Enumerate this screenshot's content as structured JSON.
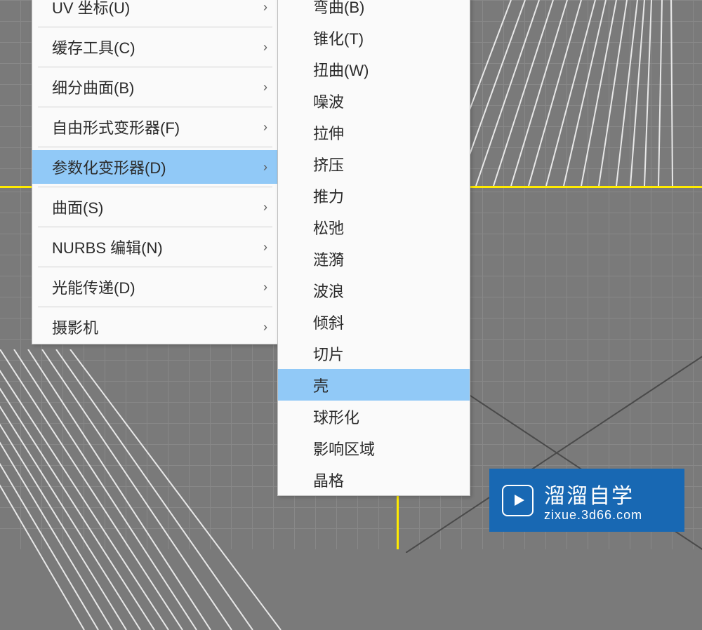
{
  "main_menu": {
    "items": [
      {
        "label": "UV 坐标(U)",
        "has_submenu": true
      },
      {
        "label": "缓存工具(C)",
        "has_submenu": true
      },
      {
        "label": "细分曲面(B)",
        "has_submenu": true
      },
      {
        "label": "自由形式变形器(F)",
        "has_submenu": true
      },
      {
        "label": "参数化变形器(D)",
        "has_submenu": true,
        "highlighted": true
      },
      {
        "label": "曲面(S)",
        "has_submenu": true
      },
      {
        "label": "NURBS 编辑(N)",
        "has_submenu": true
      },
      {
        "label": "光能传递(D)",
        "has_submenu": true
      },
      {
        "label": "摄影机",
        "has_submenu": true
      }
    ]
  },
  "sub_menu": {
    "items": [
      {
        "label": "弯曲(B)"
      },
      {
        "label": "锥化(T)"
      },
      {
        "label": "扭曲(W)"
      },
      {
        "label": "噪波"
      },
      {
        "label": "拉伸"
      },
      {
        "label": "挤压"
      },
      {
        "label": "推力"
      },
      {
        "label": "松弛"
      },
      {
        "label": "涟漪"
      },
      {
        "label": "波浪"
      },
      {
        "label": "倾斜"
      },
      {
        "label": "切片"
      },
      {
        "label": "壳",
        "highlighted": true
      },
      {
        "label": "球形化"
      },
      {
        "label": "影响区域"
      },
      {
        "label": "晶格"
      }
    ]
  },
  "watermark": {
    "title": "溜溜自学",
    "url": "zixue.3d66.com"
  }
}
